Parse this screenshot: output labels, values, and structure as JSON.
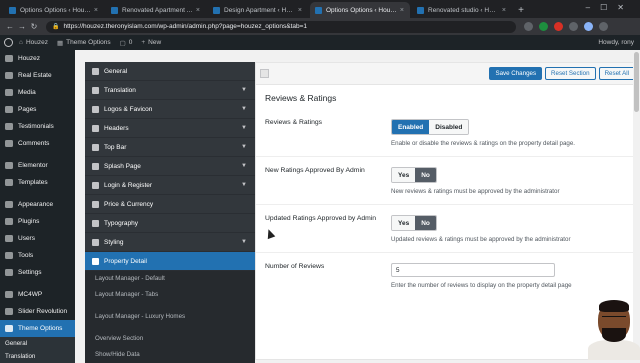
{
  "browser": {
    "tabs": [
      {
        "label": "Options Options ‹ Houzez —",
        "active": false
      },
      {
        "label": "Renovated Apartment At Last",
        "active": false
      },
      {
        "label": "Design Apartment ‹ Houzez",
        "active": false
      },
      {
        "label": "Options Options ‹ Houzez —",
        "active": true
      },
      {
        "label": "Renovated studio ‹ Houzez",
        "active": false
      }
    ],
    "new_tab": "+",
    "url": "https://houzez.theronyislam.com/wp-admin/admin.php?page=houzez_options&tab=1"
  },
  "adminbar": {
    "site_name": "Houzez",
    "theme_options": "Theme Options",
    "comments_count": "0",
    "new_label": "New",
    "howdy": "Howdy, rony"
  },
  "admin_menu": {
    "items": [
      {
        "label": "Houzez"
      },
      {
        "label": "Real Estate"
      },
      {
        "label": "Media"
      },
      {
        "label": "Pages"
      },
      {
        "label": "Testimonials"
      },
      {
        "label": "Comments"
      },
      {
        "label": "Elementor"
      },
      {
        "label": "Templates"
      },
      {
        "label": "Appearance"
      },
      {
        "label": "Plugins"
      },
      {
        "label": "Users"
      },
      {
        "label": "Tools"
      },
      {
        "label": "Settings"
      },
      {
        "label": "MC4WP"
      },
      {
        "label": "Slider Revolution"
      },
      {
        "label": "Theme Options"
      }
    ],
    "sub_items": [
      "General",
      "Translation"
    ]
  },
  "options_nav": {
    "items": [
      {
        "label": "General"
      },
      {
        "label": "Translation"
      },
      {
        "label": "Logos & Favicon"
      },
      {
        "label": "Headers"
      },
      {
        "label": "Top Bar"
      },
      {
        "label": "Splash Page"
      },
      {
        "label": "Login & Register"
      },
      {
        "label": "Price & Currency"
      },
      {
        "label": "Typography"
      },
      {
        "label": "Styling"
      },
      {
        "label": "Property Detail"
      }
    ],
    "sub_items": [
      "Layout Manager - Default",
      "Layout Manager - Tabs",
      "Layout Manager - Luxury Homes",
      "Overview Section",
      "Show/Hide Data"
    ]
  },
  "toolbar": {
    "save_label": "Save Changes",
    "reset_section_label": "Reset Section",
    "reset_all_label": "Reset All"
  },
  "section": {
    "title": "Reviews & Ratings",
    "fields": [
      {
        "label": "Reviews & Ratings",
        "options": [
          "Enabled",
          "Disabled"
        ],
        "selected": "Enabled",
        "description": "Enable or disable the reviews & ratings on the property detail page."
      },
      {
        "label": "New Ratings Approved By Admin",
        "options": [
          "Yes",
          "No"
        ],
        "selected": "No",
        "description": "New reviews & ratings must be approved by the administrator"
      },
      {
        "label": "Updated Ratings Approved by Admin",
        "options": [
          "Yes",
          "No"
        ],
        "selected": "No",
        "description": "Updated reviews & ratings must be approved by the administrator"
      },
      {
        "label": "Number of Reviews",
        "value": "5",
        "description": "Enter the number of reviews to display on the property detail page"
      }
    ]
  },
  "colors": {
    "wp_accent": "#2271b1",
    "admin_bar": "#1d2327",
    "panel_nav": "#32373c"
  }
}
